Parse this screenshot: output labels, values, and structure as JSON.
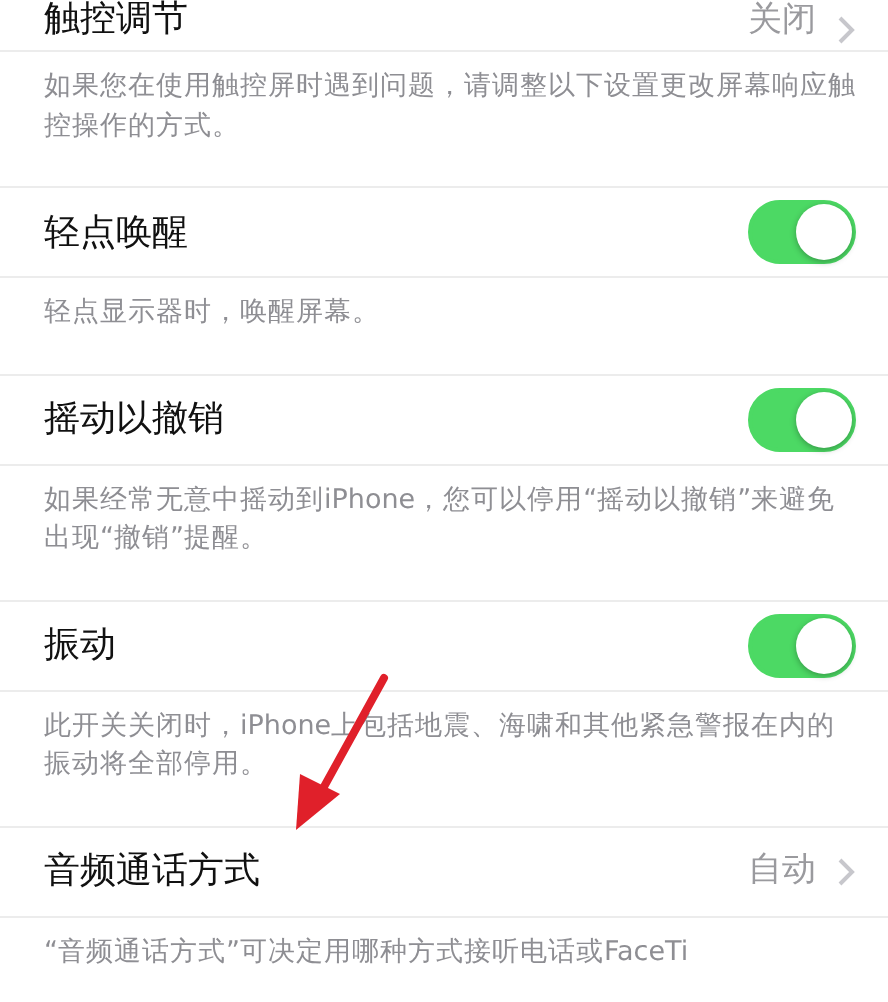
{
  "items": [
    {
      "kind": "link",
      "label": "触控调节",
      "value": "关闭",
      "note": "如果您在使用触控屏时遇到问题，请调整以下设置更改屏幕响应触控操作的方式。"
    },
    {
      "kind": "toggle",
      "label": "轻点唤醒",
      "on": true,
      "note": "轻点显示器时，唤醒屏幕。"
    },
    {
      "kind": "toggle",
      "label": "摇动以撤销",
      "on": true,
      "note": "如果经常无意中摇动到iPhone，您可以停用“摇动以撤销”来避免出现“撤销”提醒。"
    },
    {
      "kind": "toggle",
      "label": "振动",
      "on": true,
      "note": "此开关关闭时，iPhone上包括地震、海啸和其他紧急警报在内的振动将全部停用。"
    },
    {
      "kind": "link",
      "label": "音频通话方式",
      "value": "自动",
      "note": "“音频通话方式”可决定用哪种方式接听电话或FaceTi"
    }
  ]
}
